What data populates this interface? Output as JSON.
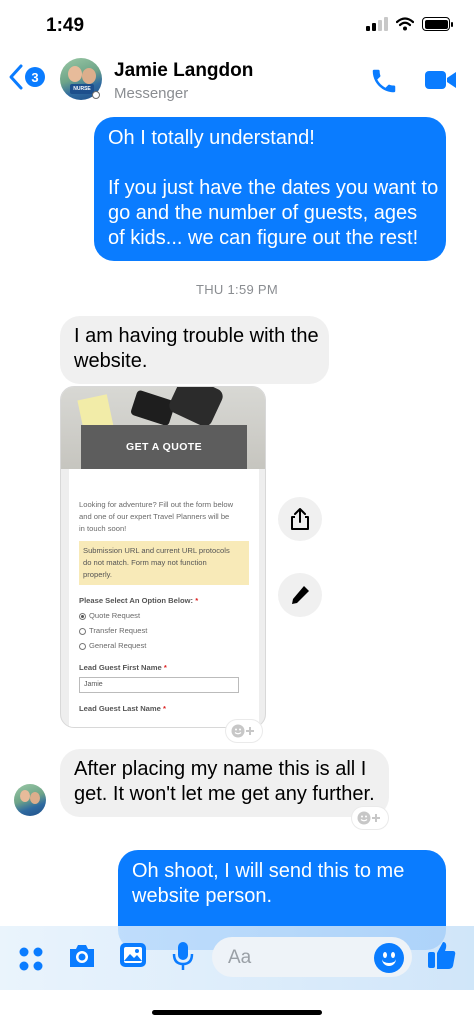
{
  "status_bar": {
    "time": "1:49"
  },
  "header": {
    "unread_count": "3",
    "contact_name": "Jamie Langdon",
    "contact_subtitle": "Messenger",
    "avatar_logo_text": "NURSE"
  },
  "messages": [
    {
      "direction": "outgoing",
      "lines": [
        "Oh I totally understand!",
        "",
        "If you just have the dates you want to",
        "go and the number of guests, ages",
        "of kids... we can figure out the rest!"
      ]
    },
    {
      "direction": "incoming",
      "lines": [
        "I am having trouble with the",
        "website."
      ]
    },
    {
      "direction": "incoming",
      "lines": [
        "After placing my name this is all I",
        "get. It won't let me get any further."
      ]
    },
    {
      "direction": "outgoing",
      "lines": [
        "Oh shoot, I will send this to me",
        "website person."
      ]
    }
  ],
  "timestamp": "THU 1:59 PM",
  "shared_image": {
    "overlay_button": "GET A QUOTE",
    "intro_lines": [
      "Looking for adventure? Fill out the form below",
      "and one of our expert Travel Planners will be",
      "in touch soon!"
    ],
    "warning_lines": [
      "Submission URL and current URL protocols",
      "do not match. Form may not function",
      "properly."
    ],
    "option_label": "Please Select An Option Below:",
    "required_mark": "*",
    "options": [
      {
        "label": "Quote Request",
        "selected": true
      },
      {
        "label": "Transfer Request",
        "selected": false
      },
      {
        "label": "General Request",
        "selected": false
      }
    ],
    "first_name_label": "Lead Guest First Name",
    "first_name_value": "Jamie",
    "last_name_label": "Lead Guest Last Name"
  },
  "composer": {
    "placeholder": "Aa"
  },
  "colors": {
    "accent": "#0a7cff",
    "incoming_bubble": "#f0f0f0",
    "meta_text": "#8a8d91"
  },
  "icons": [
    "back-chevron-icon",
    "phone-icon",
    "video-camera-icon",
    "share-icon",
    "pencil-icon",
    "add-reaction-icon",
    "menu-dots-icon",
    "camera-icon",
    "photo-icon",
    "microphone-icon",
    "emoji-icon",
    "thumbs-up-icon"
  ]
}
